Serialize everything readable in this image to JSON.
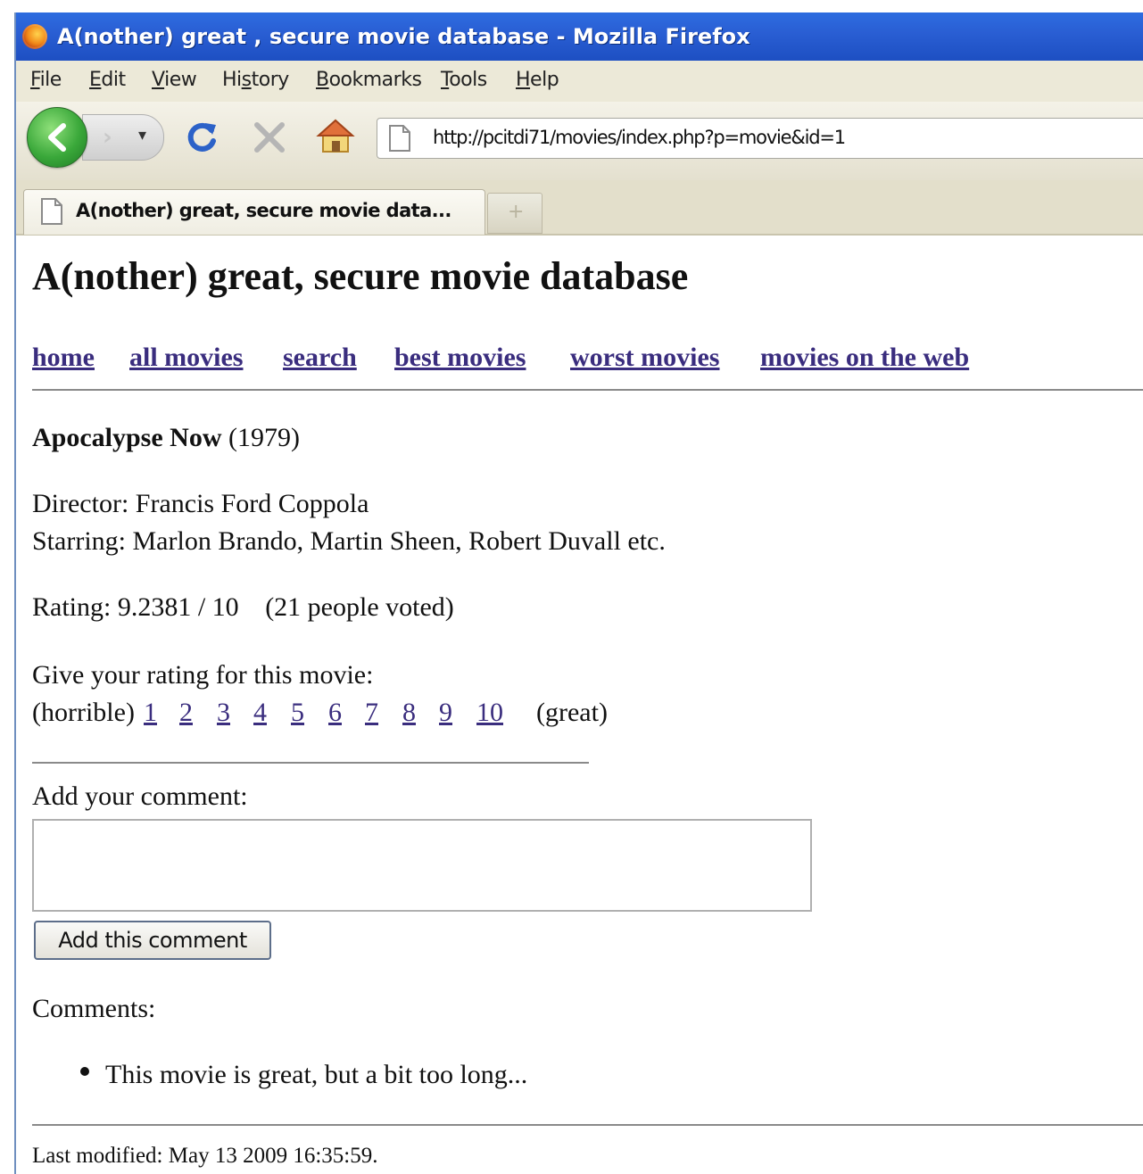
{
  "window": {
    "title": "A(nother) great , secure movie database - Mozilla Firefox"
  },
  "menu": {
    "items": [
      {
        "label": "File",
        "mnemonic": "F"
      },
      {
        "label": "Edit",
        "mnemonic": "E"
      },
      {
        "label": "View",
        "mnemonic": "V"
      },
      {
        "label": "History",
        "mnemonic": "s"
      },
      {
        "label": "Bookmarks",
        "mnemonic": "B"
      },
      {
        "label": "Tools",
        "mnemonic": "T"
      },
      {
        "label": "Help",
        "mnemonic": "H"
      }
    ]
  },
  "toolbar": {
    "icons": [
      "back-icon",
      "forward-icon",
      "history-dropdown-icon",
      "reload-icon",
      "stop-icon",
      "home-icon"
    ],
    "url": "http://pcitdi71/movies/index.php?p=movie&id=1"
  },
  "tabs": [
    {
      "label": "A(nother) great, secure movie data...",
      "active": true
    }
  ],
  "page": {
    "title": "A(nother) great, secure movie database",
    "nav": [
      "home",
      "all movies",
      "search",
      "best movies",
      "worst movies",
      "movies on the web"
    ],
    "movie": {
      "name": "Apocalypse Now",
      "year": "(1979)",
      "director_label": "Director:",
      "director": "Francis Ford Coppola",
      "starring_label": "Starring:",
      "starring": "Marlon Brando, Martin Sheen, Robert Duvall etc.",
      "rating_label": "Rating:",
      "rating": "9.2381 / 10",
      "votes": "(21 people voted)"
    },
    "rate": {
      "prompt": "Give your rating for this movie:",
      "low_label": "(horrible)",
      "options": [
        "1",
        "2",
        "3",
        "4",
        "5",
        "6",
        "7",
        "8",
        "9",
        "10"
      ],
      "high_label": "(great)"
    },
    "comment_form": {
      "label": "Add your comment:",
      "value": "",
      "button": "Add this comment"
    },
    "comments": {
      "heading": "Comments:",
      "items": [
        "This movie is great, but a bit too long..."
      ]
    },
    "footer": "Last modified: May 13 2009 16:35:59."
  },
  "colors": {
    "titlebar": "#2a5fd4",
    "link": "#3a2d7e",
    "chrome": "#ece9d8"
  }
}
